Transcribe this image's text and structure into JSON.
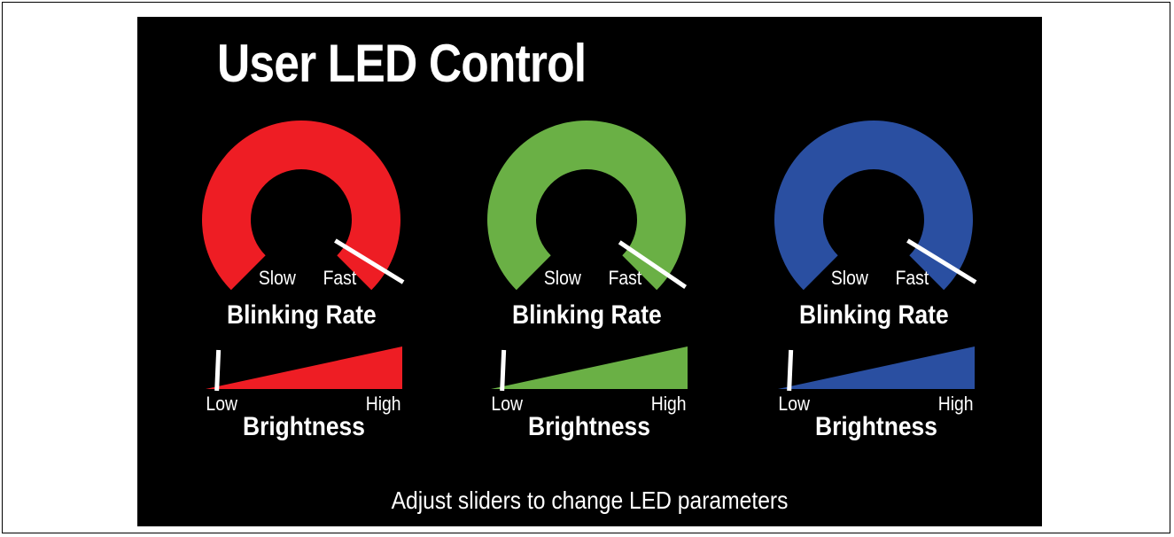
{
  "title": "User LED Control",
  "modules": [
    {
      "color": "#ee1d24",
      "blinking_rate": {
        "label": "Blinking Rate",
        "slow_label": "Slow",
        "fast_label": "Fast",
        "level": 0.95
      },
      "brightness": {
        "label": "Brightness",
        "low_label": "Low",
        "high_label": "High",
        "level": 0.03
      }
    },
    {
      "color": "#6ab045",
      "blinking_rate": {
        "label": "Blinking Rate",
        "slow_label": "Slow",
        "fast_label": "Fast",
        "level": 0.96
      },
      "brightness": {
        "label": "Brightness",
        "low_label": "Low",
        "high_label": "High",
        "level": 0.03
      }
    },
    {
      "color": "#2a4fa1",
      "blinking_rate": {
        "label": "Blinking Rate",
        "slow_label": "Slow",
        "fast_label": "Fast",
        "level": 0.95
      },
      "brightness": {
        "label": "Brightness",
        "low_label": "Low",
        "high_label": "High",
        "level": 0.03
      }
    }
  ],
  "footer": "Adjust sliders to change LED parameters"
}
